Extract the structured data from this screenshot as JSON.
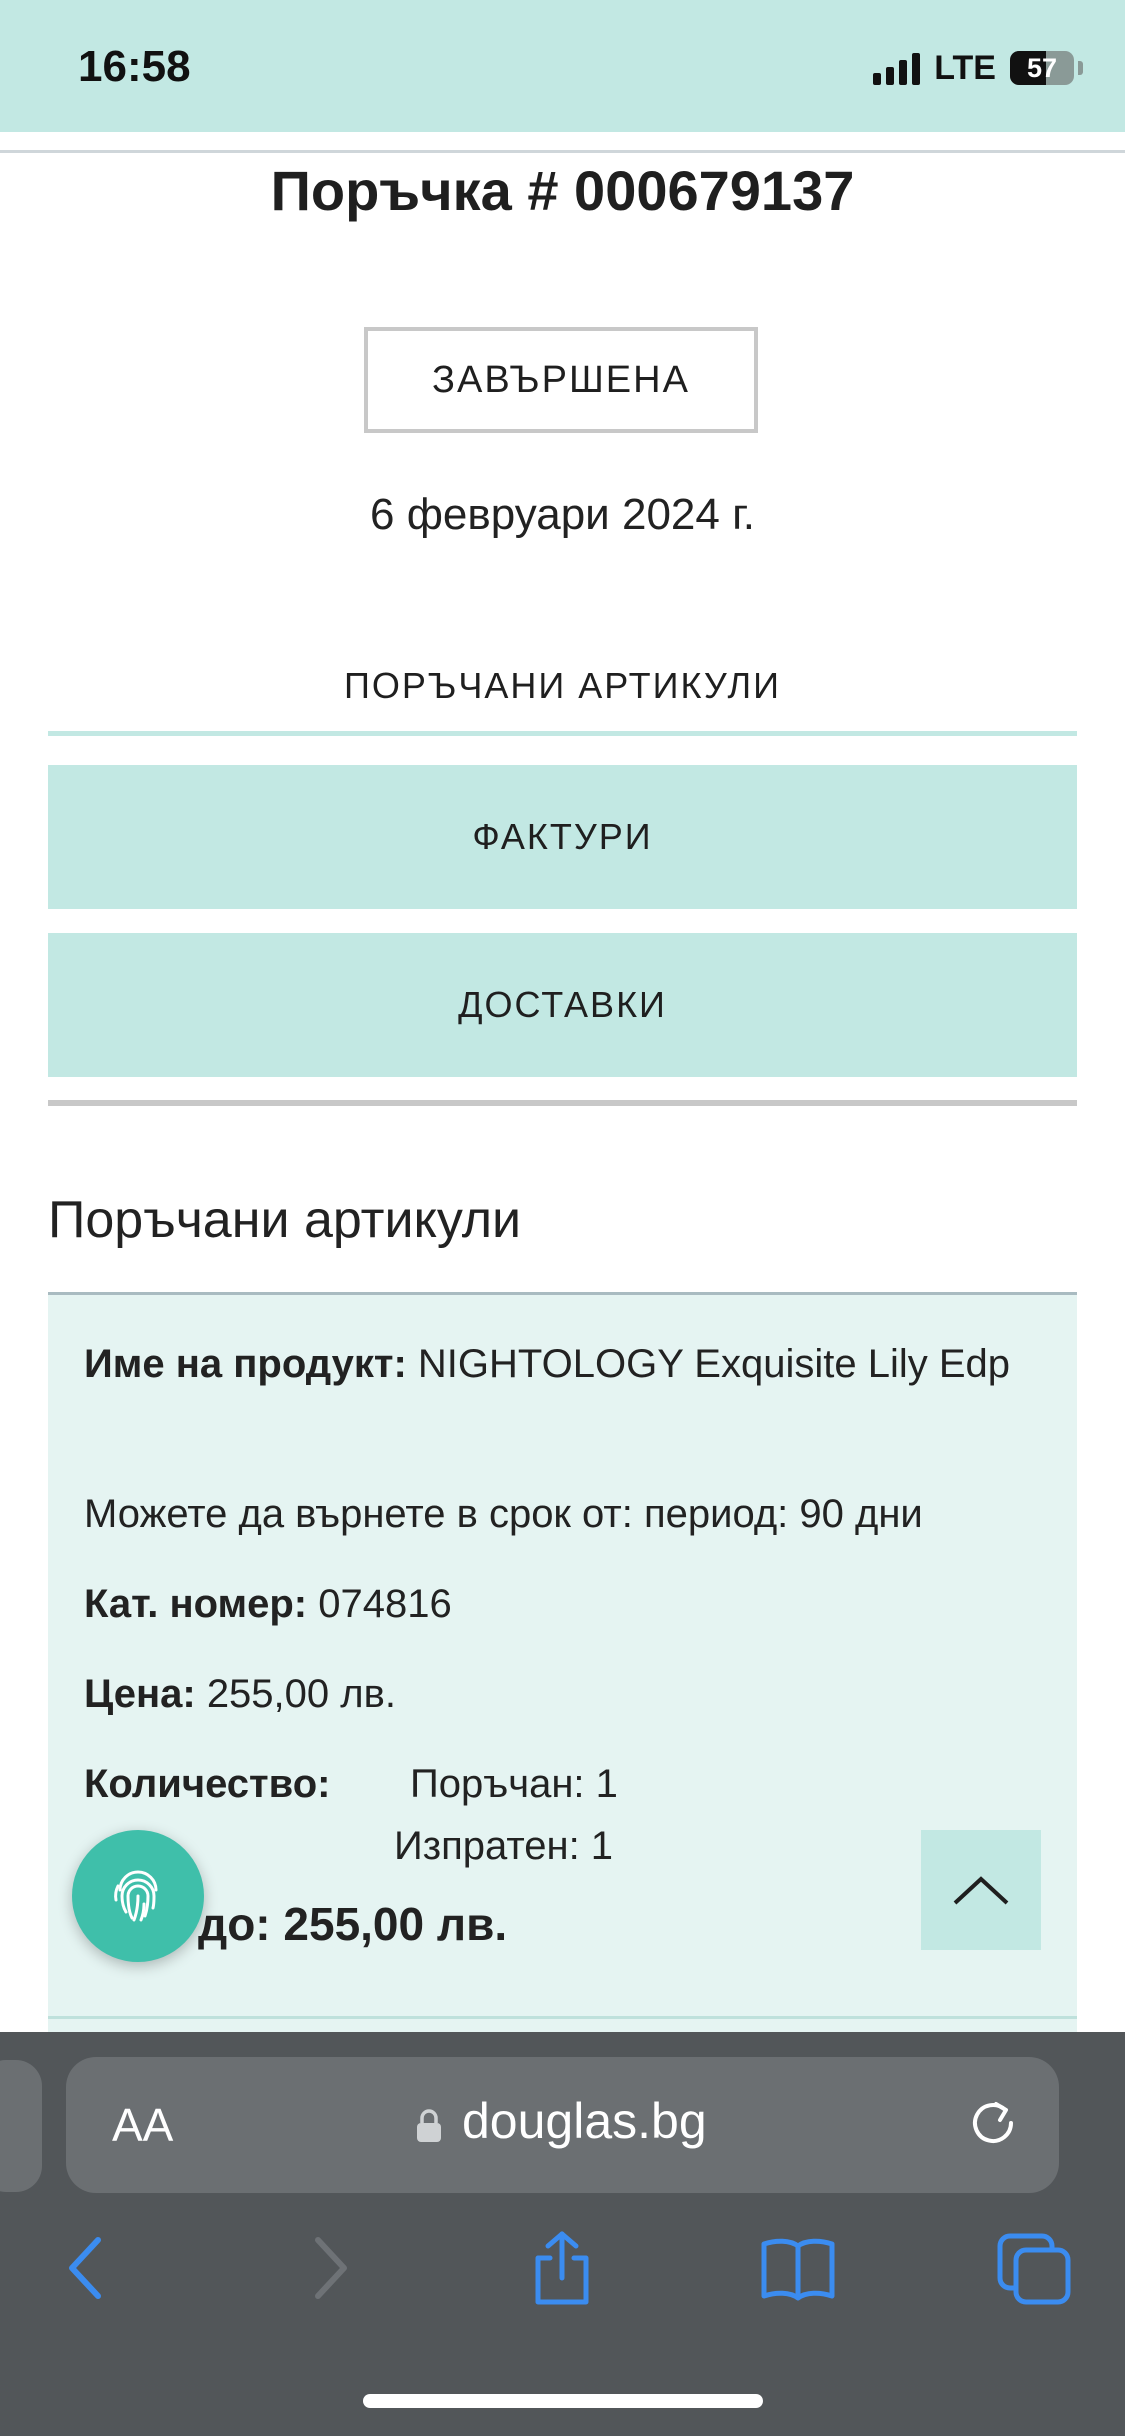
{
  "status_bar": {
    "time": "16:58",
    "network": "LTE",
    "battery": "57",
    "battery_level": 0.57
  },
  "order": {
    "title": "Поръчка # 000679137",
    "status": "ЗАВЪРШЕНА",
    "date": "6 февруари 2024 г."
  },
  "tabs": {
    "ordered_items": "ПОРЪЧАНИ АРТИКУЛИ",
    "invoices": "ФАКТУРИ",
    "deliveries": "ДОСТАВКИ"
  },
  "section": {
    "heading": "Поръчани артикули"
  },
  "product": {
    "name_label": "Име на продукт:",
    "name_value": "NIGHTOLOGY Exquisite Lily Edp",
    "return_period": "Можете да върнете в срок от: период: 90 дни",
    "cat_label": "Кат. номер:",
    "cat_value": "074816",
    "price_label": "Цена:",
    "price_value": "255,00 лв.",
    "qty_label": "Количество:",
    "qty_ordered": "Поръчан: 1",
    "qty_shipped": "Изпратен: 1",
    "total_partial_label": "до:",
    "total_value": "255,00 лв."
  },
  "browser": {
    "aa": "AA",
    "url": "douglas.bg"
  },
  "colors": {
    "mint": "#c2e8e3",
    "card": "#e5f4f2",
    "fab": "#3fbfaa",
    "safari_dark": "#525659",
    "ios_blue": "#3b8cf0"
  },
  "icons": [
    "signal-icon",
    "battery-icon",
    "fingerprint-icon",
    "chevron-up-icon",
    "lock-icon",
    "reload-icon",
    "back-icon",
    "forward-icon",
    "share-icon",
    "bookmarks-icon",
    "tabs-icon"
  ]
}
